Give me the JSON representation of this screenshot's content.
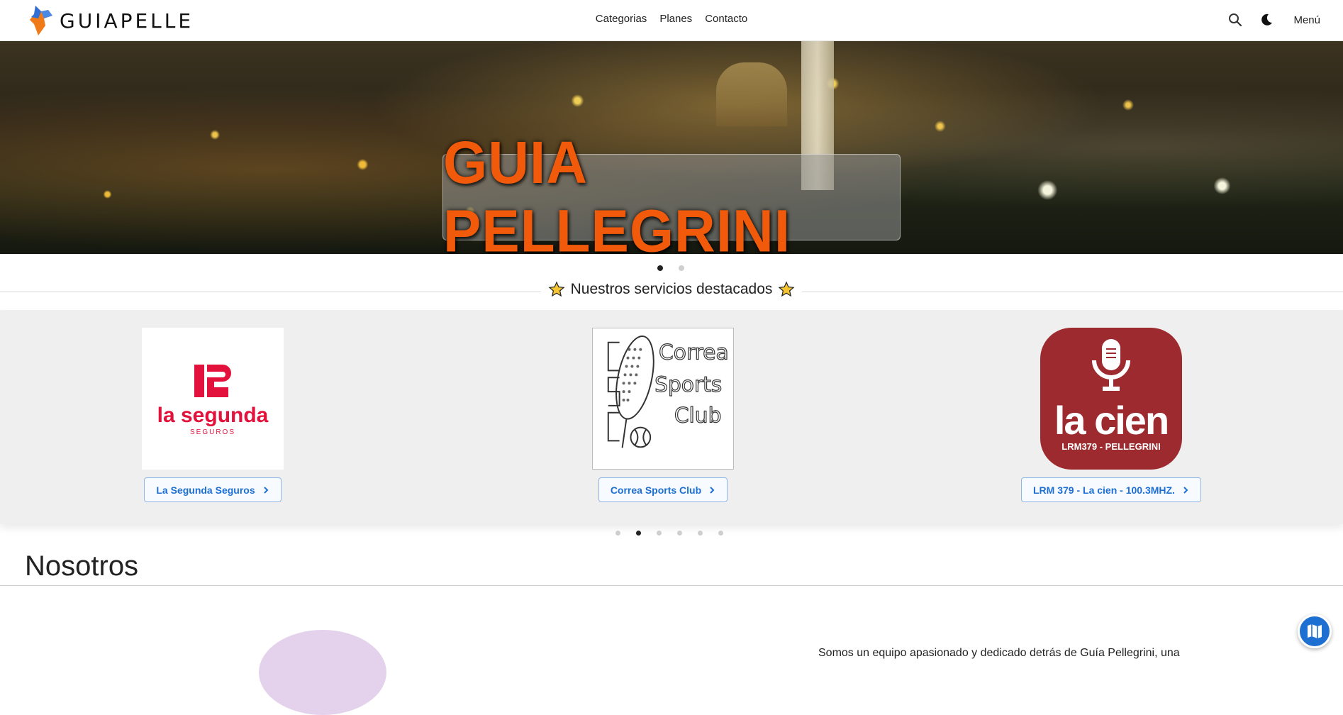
{
  "header": {
    "logo_text": "GUIAPELLE",
    "nav": [
      "Categorias",
      "Planes",
      "Contacto"
    ],
    "menu_label": "Menú"
  },
  "hero": {
    "title": "GUIA PELLEGRINI",
    "slide_count": 2,
    "active_slide": 1
  },
  "featured": {
    "title": "Nuestros servicios destacados",
    "cards": [
      {
        "button_label": "La Segunda Seguros",
        "logo_text": "la segunda",
        "logo_sub": "SEGUROS"
      },
      {
        "button_label": "Correa Sports Club",
        "logo_text": "Correa Sports Club",
        "logo_letters": "CSC"
      },
      {
        "button_label": "LRM 379 - La cien - 100.3MHZ.",
        "logo_text": "la cien",
        "logo_sub": "LRM379 - PELLEGRINI"
      }
    ],
    "page_count": 6,
    "active_page": 2
  },
  "about": {
    "title": "Nosotros",
    "text": "Somos un equipo apasionado y dedicado detrás de Guía Pellegrini, una"
  },
  "colors": {
    "accent": "#1d6fd1",
    "hero_title": "#f05a0a",
    "la_segunda_red": "#e3123c",
    "la_cien_red": "#9c2a2e"
  }
}
